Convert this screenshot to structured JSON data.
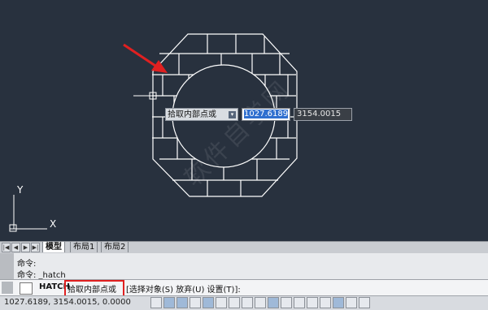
{
  "dynamic_input": {
    "prompt": "拾取内部点或",
    "dropdown_glyph": "▾",
    "x_value": "1027.6189",
    "y_value": "3154.0015"
  },
  "watermark": "软件自学网",
  "ucs": {
    "y_label": "Y",
    "x_label": "X"
  },
  "tabs": {
    "nav": [
      "|◀",
      "◀",
      "▶",
      "▶|"
    ],
    "items": [
      "模型",
      "布局1",
      "布局2"
    ]
  },
  "command_history": [
    "命令:",
    "命令: _hatch"
  ],
  "command_input": {
    "name": "HATCH",
    "prompt": "拾取内部点或",
    "options": "[选择对象(S) 放弃(U) 设置(T)]:"
  },
  "status_bar": {
    "coordinates": "1027.6189, 3154.0015, 0.0000"
  },
  "colors": {
    "canvas": "#28313e",
    "drawing_lines": "#ffffff",
    "highlight": "#e02020",
    "annotation_arrow": "#e02020"
  }
}
